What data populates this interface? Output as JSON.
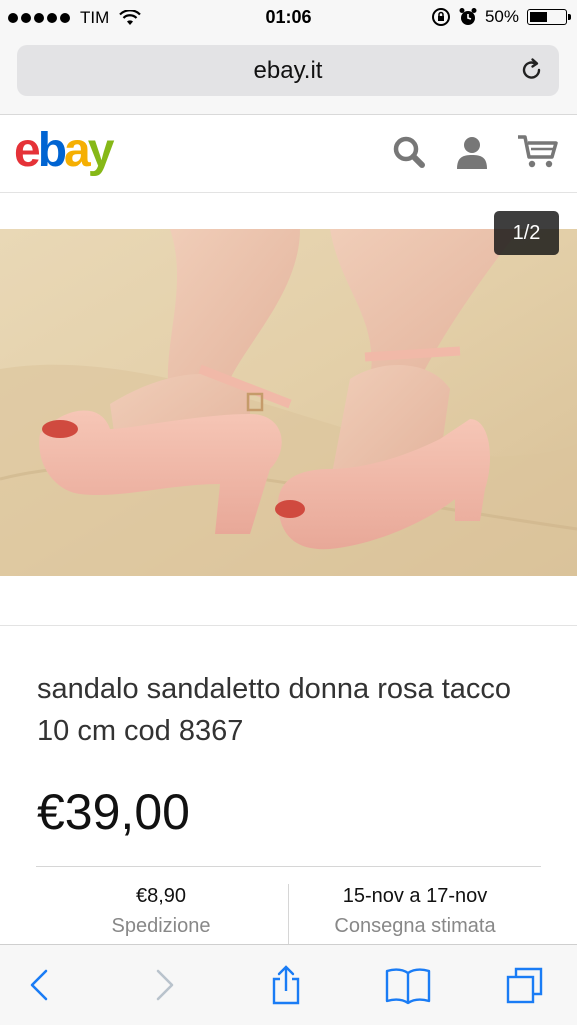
{
  "status_bar": {
    "carrier": "TIM",
    "time": "01:06",
    "battery_percent": "50%",
    "battery_level": 0.5
  },
  "browser": {
    "url": "ebay.it"
  },
  "header": {
    "logo": [
      "e",
      "b",
      "a",
      "y"
    ],
    "logo_colors": [
      "#e53238",
      "#0064d2",
      "#f5af02",
      "#86b817"
    ]
  },
  "gallery": {
    "counter": "1/2"
  },
  "item": {
    "title": "sandalo sandaletto donna rosa tacco 10 cm cod 8367",
    "price": "€39,00",
    "shipping_value": "€8,90",
    "shipping_label": "Spedizione",
    "delivery_value": "15-nov a 17-nov",
    "delivery_label": "Consegna stimata"
  },
  "toolbar": {
    "icons": [
      "back-icon",
      "forward-icon",
      "share-icon",
      "bookmarks-icon",
      "tabs-icon"
    ]
  },
  "colors": {
    "ios_blue": "#1a7cf5",
    "disabled": "#b9c3cc"
  }
}
